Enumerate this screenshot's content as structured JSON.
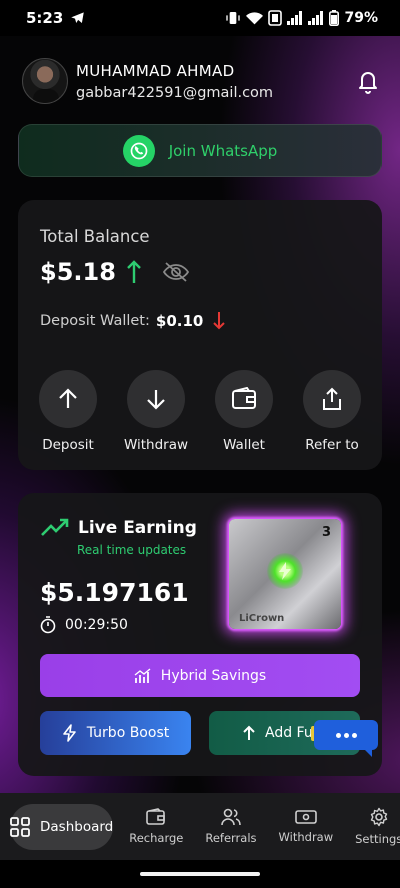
{
  "status_bar": {
    "time": "5:23",
    "battery": "79%",
    "icons": [
      "telegram-icon",
      "vibrate-icon",
      "wifi-icon",
      "volte-icon",
      "signal-icon",
      "signal-icon",
      "battery-icon"
    ]
  },
  "user": {
    "name": "MUHAMMAD AHMAD",
    "email": "gabbar422591@gmail.com",
    "notification_icon": "bell-icon"
  },
  "whatsapp": {
    "label": "Join WhatsApp",
    "icon": "whatsapp-icon"
  },
  "balance": {
    "label": "Total Balance",
    "value": "$5.18",
    "trend": "up",
    "deposit_label": "Deposit Wallet:",
    "deposit_value": "$0.10",
    "deposit_trend": "down"
  },
  "actions": [
    {
      "label": "Deposit",
      "icon": "arrow-up-icon"
    },
    {
      "label": "Withdraw",
      "icon": "arrow-down-icon"
    },
    {
      "label": "Wallet",
      "icon": "wallet-icon"
    },
    {
      "label": "Refer to",
      "icon": "share-icon"
    }
  ],
  "earning": {
    "title": "Live Earning",
    "subtitle": "Real time updates",
    "value": "$5.197161",
    "timer": "00:29:50",
    "card_number": "3",
    "card_brand": "LiCrown"
  },
  "buttons": {
    "hybrid": "Hybrid Savings",
    "turbo": "Turbo Boost",
    "add_funds": "Add Fun"
  },
  "nav": [
    {
      "label": "Dashboard",
      "icon": "grid-icon",
      "active": true
    },
    {
      "label": "Recharge",
      "icon": "wallet-icon",
      "active": false
    },
    {
      "label": "Referrals",
      "icon": "users-icon",
      "active": false
    },
    {
      "label": "Withdraw",
      "icon": "cash-icon",
      "active": false
    },
    {
      "label": "Settings",
      "icon": "gear-icon",
      "active": false
    }
  ],
  "colors": {
    "accent_green": "#2ecc71",
    "hybrid_purple": "#9a3fe8",
    "turbo_blue": "#3a84f0",
    "add_funds_teal": "#125c46",
    "down_red": "#e53935"
  }
}
